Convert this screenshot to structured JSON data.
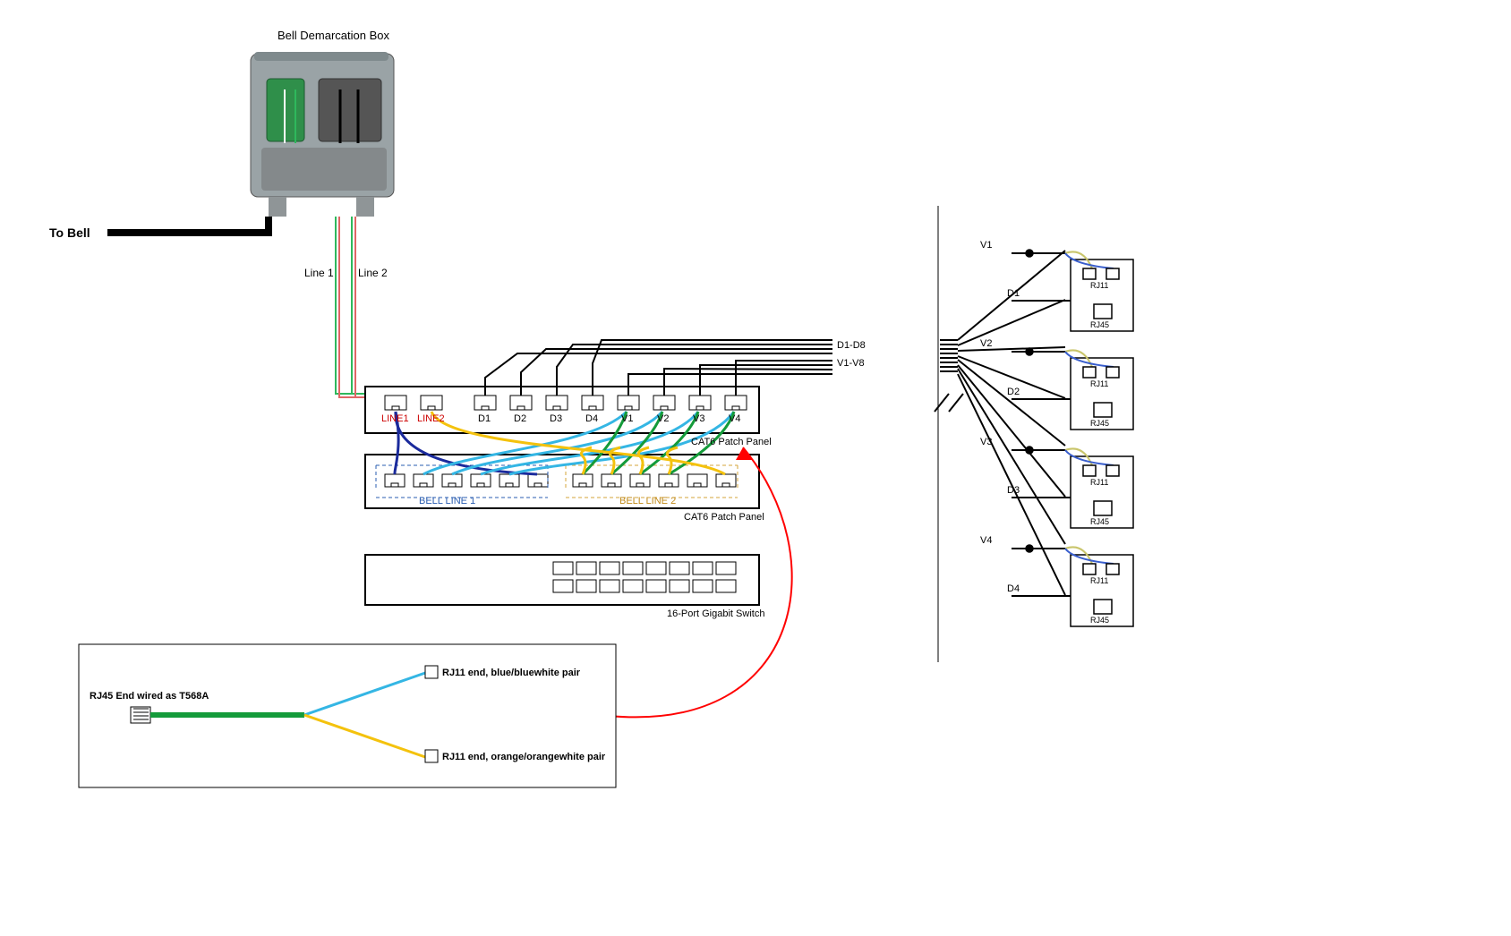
{
  "title": "Bell Demarcation Box",
  "to_bell": "To Bell",
  "line1": "Line 1",
  "line2": "Line 2",
  "patch_top": {
    "ports": [
      "LINE1",
      "LINE2",
      "D1",
      "D2",
      "D3",
      "D4",
      "V1",
      "V2",
      "V3",
      "V4"
    ],
    "label": "CAT6 Patch Panel"
  },
  "patch_bottom": {
    "bell1": "BELL LINE 1",
    "bell2": "BELL LINE 2",
    "label": "CAT6 Patch Panel"
  },
  "switch_label": "16-Port Gigabit Switch",
  "bundles": {
    "d": "D1-D8",
    "v": "V1-V8"
  },
  "legend": {
    "rj45": "RJ45 End wired as T568A",
    "rj11_blue": "RJ11 end, blue/bluewhite pair",
    "rj11_orange": "RJ11 end, orange/orangewhite pair"
  },
  "wallplates": [
    {
      "v": "V1",
      "d": "D1"
    },
    {
      "v": "V2",
      "d": "D2"
    },
    {
      "v": "V3",
      "d": "D3"
    },
    {
      "v": "V4",
      "d": "D4"
    }
  ],
  "jack": {
    "rj11": "RJ11",
    "rj45": "RJ45"
  }
}
